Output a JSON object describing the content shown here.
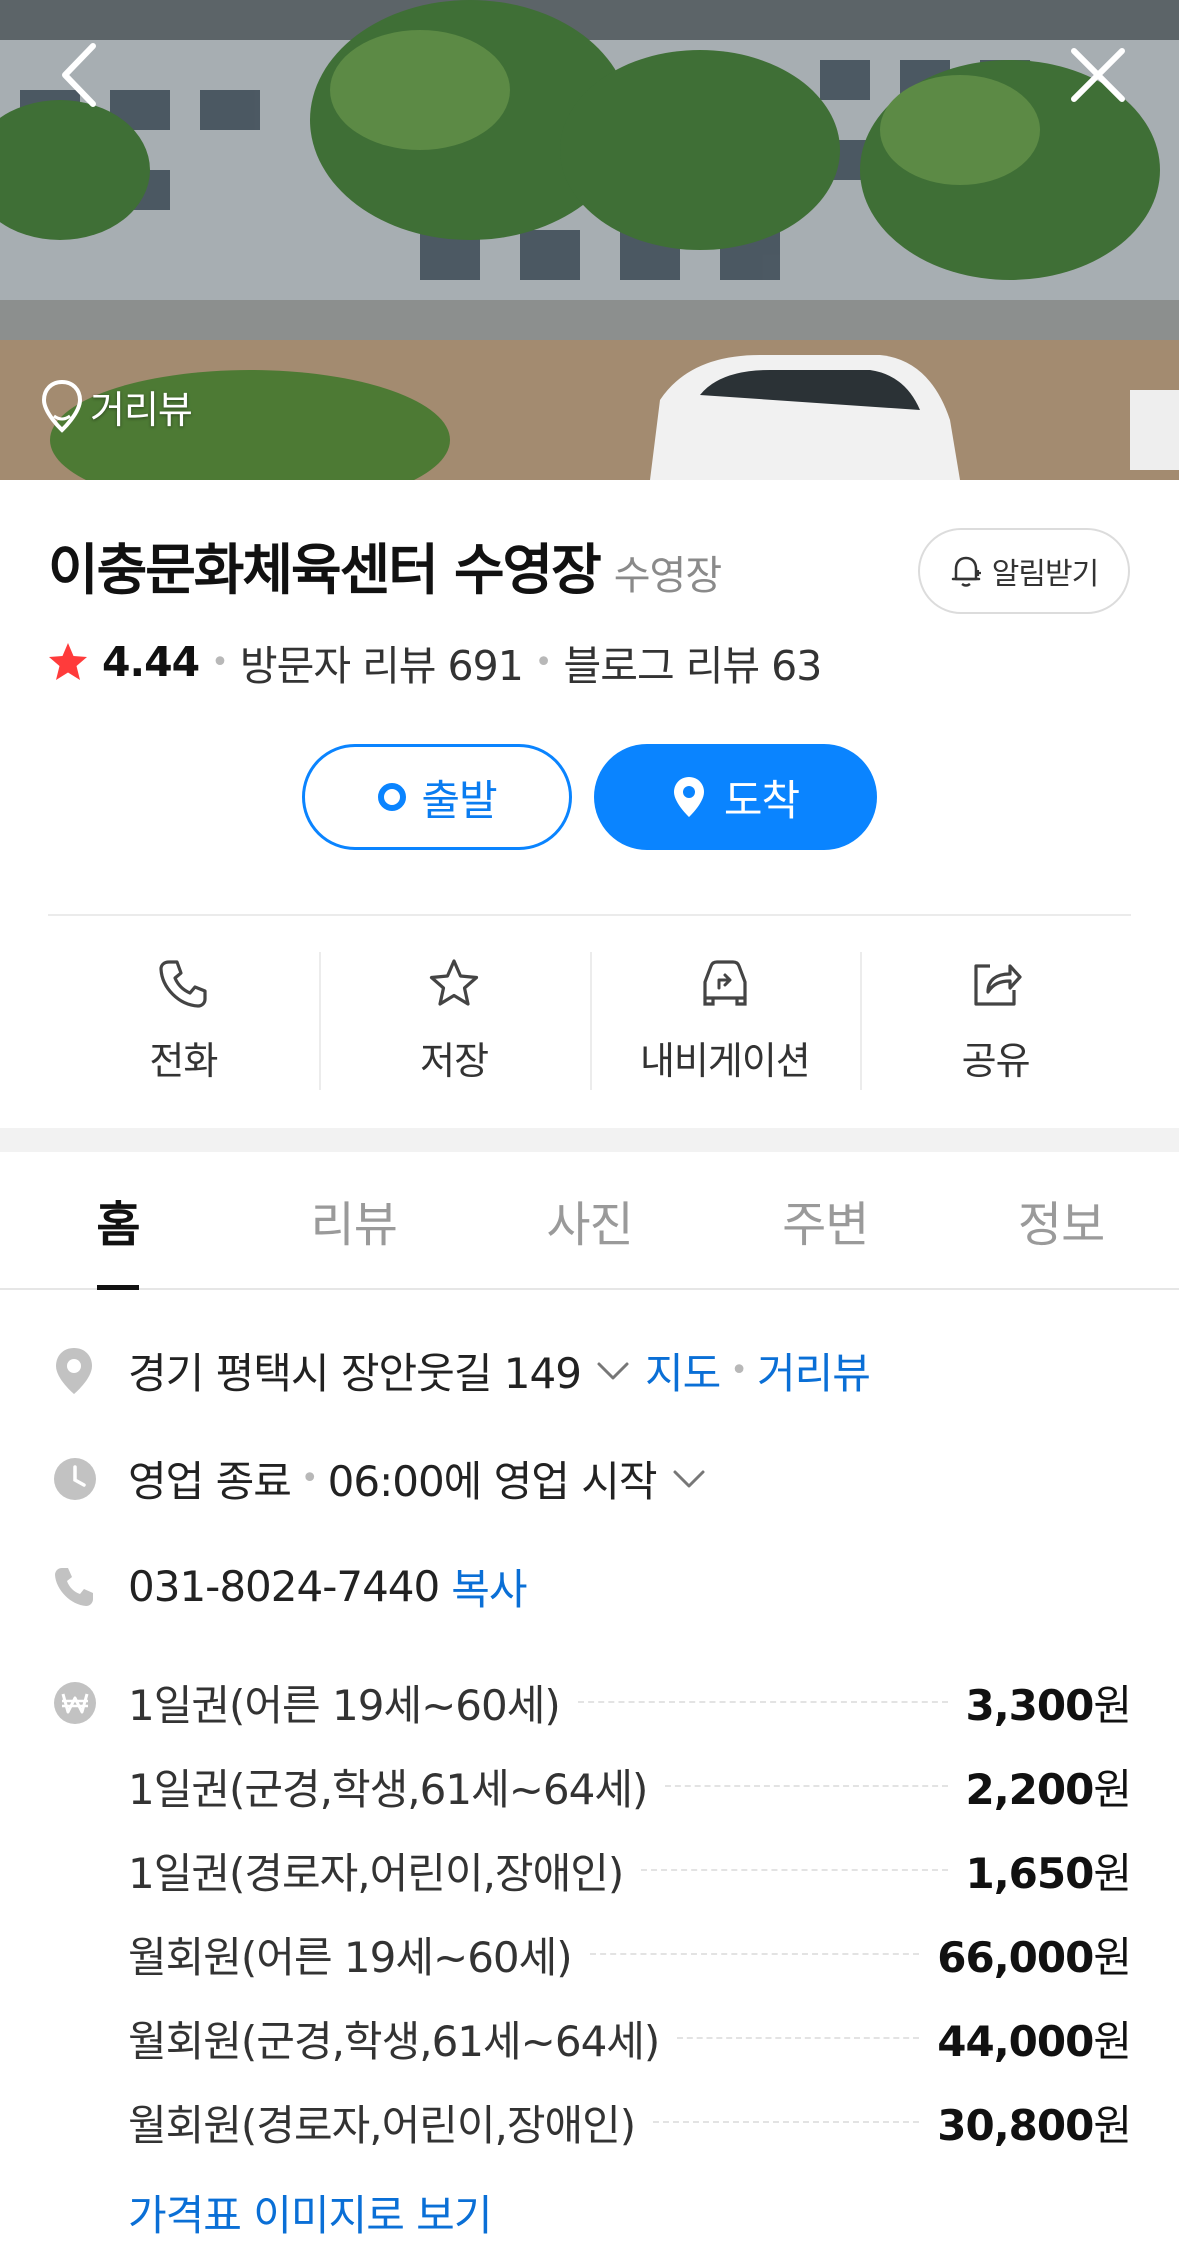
{
  "hero": {
    "back_icon": "chevron-left-icon",
    "close_icon": "close-icon",
    "streetview_label": "거리뷰"
  },
  "place": {
    "name": "이충문화체육센터 수영장",
    "category": "수영장",
    "alert_label": "알림받기",
    "rating": "4.44",
    "visitor_reviews": "방문자 리뷰 691",
    "blog_reviews": "블로그 리뷰 63"
  },
  "route": {
    "depart_label": "출발",
    "arrive_label": "도착"
  },
  "actions": [
    {
      "label": "전화",
      "icon": "phone-icon"
    },
    {
      "label": "저장",
      "icon": "star-icon"
    },
    {
      "label": "내비게이션",
      "icon": "car-navigation-icon"
    },
    {
      "label": "공유",
      "icon": "share-icon"
    }
  ],
  "tabs": [
    {
      "label": "홈",
      "active": true
    },
    {
      "label": "리뷰",
      "active": false
    },
    {
      "label": "사진",
      "active": false
    },
    {
      "label": "주변",
      "active": false
    },
    {
      "label": "정보",
      "active": false
    }
  ],
  "info": {
    "address": "경기 평택시 장안웃길 149",
    "map_link": "지도",
    "streetview_link": "거리뷰",
    "hours_status": "영업 종료",
    "hours_next": "06:00에 영업 시작",
    "phone": "031-8024-7440",
    "copy_label": "복사"
  },
  "prices": [
    {
      "name": "1일권(어른 19세~60세)",
      "value": "3,300",
      "unit": "원"
    },
    {
      "name": "1일권(군경,학생,61세~64세)",
      "value": "2,200",
      "unit": "원"
    },
    {
      "name": "1일권(경로자,어린이,장애인)",
      "value": "1,650",
      "unit": "원"
    },
    {
      "name": "월회원(어른 19세~60세)",
      "value": "66,000",
      "unit": "원"
    },
    {
      "name": "월회원(군경,학생,61세~64세)",
      "value": "44,000",
      "unit": "원"
    },
    {
      "name": "월회원(경로자,어린이,장애인)",
      "value": "30,800",
      "unit": "원"
    }
  ],
  "price_image_link": "가격표 이미지로 보기",
  "colors": {
    "accent_blue": "#0a84ff",
    "link_blue": "#0a6fd6",
    "star_red": "#ff3b3b"
  }
}
